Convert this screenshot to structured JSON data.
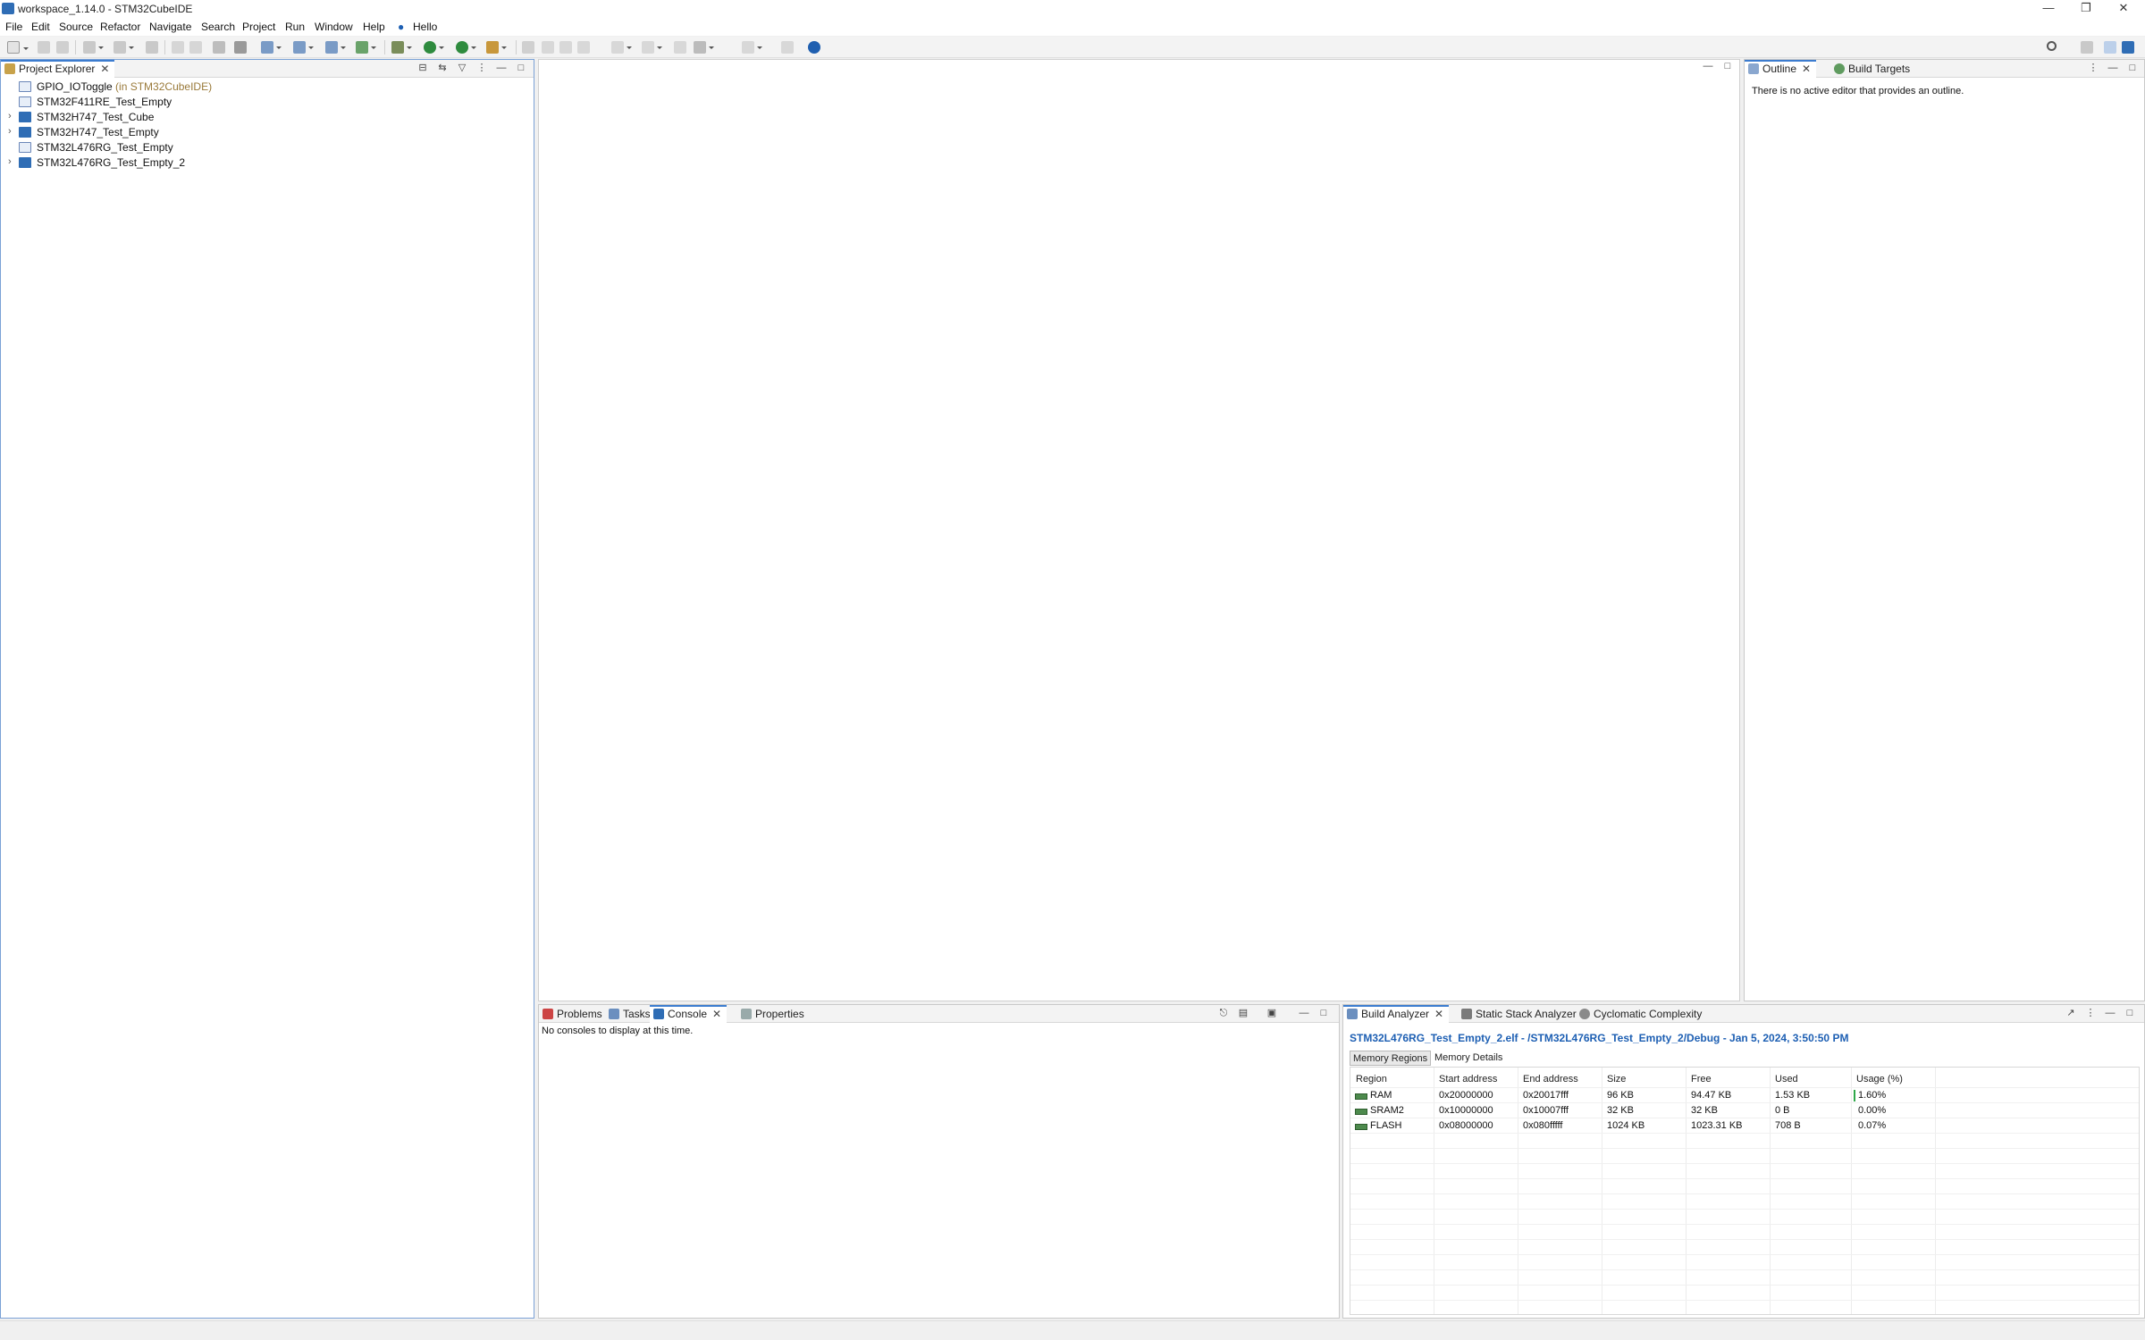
{
  "window": {
    "title": "workspace_1.14.0 - STM32CubeIDE"
  },
  "menu": [
    "File",
    "Edit",
    "Source",
    "Refactor",
    "Navigate",
    "Search",
    "Project",
    "Run",
    "Window",
    "Help",
    "Hello"
  ],
  "project_explorer": {
    "tab_label": "Project Explorer",
    "items": [
      {
        "label": "GPIO_IOToggle",
        "suffix": " (in STM32CubeIDE)",
        "expandable": false,
        "icon": "folder-icon"
      },
      {
        "label": "STM32F411RE_Test_Empty",
        "suffix": "",
        "expandable": false,
        "icon": "folder-icon"
      },
      {
        "label": "STM32H747_Test_Cube",
        "suffix": "",
        "expandable": true,
        "icon": "cube-project-icon"
      },
      {
        "label": "STM32H747_Test_Empty",
        "suffix": "",
        "expandable": true,
        "icon": "cube-project-icon"
      },
      {
        "label": "STM32L476RG_Test_Empty",
        "suffix": "",
        "expandable": false,
        "icon": "folder-icon"
      },
      {
        "label": "STM32L476RG_Test_Empty_2",
        "suffix": "",
        "expandable": true,
        "icon": "cube-project-icon"
      }
    ]
  },
  "outline": {
    "tab_outline": "Outline",
    "tab_build_targets": "Build Targets",
    "message": "There is no active editor that provides an outline."
  },
  "console": {
    "tabs": [
      "Problems",
      "Tasks",
      "Console",
      "Properties"
    ],
    "message": "No consoles to display at this time."
  },
  "build_analyzer": {
    "tabs": [
      "Build Analyzer",
      "Static Stack Analyzer",
      "Cyclomatic Complexity"
    ],
    "header": "STM32L476RG_Test_Empty_2.elf - /STM32L476RG_Test_Empty_2/Debug - Jan 5, 2024, 3:50:50 PM",
    "subtabs": [
      "Memory Regions",
      "Memory Details"
    ],
    "columns": [
      "Region",
      "Start address",
      "End address",
      "Size",
      "Free",
      "Used",
      "Usage (%)"
    ],
    "rows": [
      [
        "RAM",
        "0x20000000",
        "0x20017fff",
        "96 KB",
        "94.47 KB",
        "1.53 KB",
        "1.60%"
      ],
      [
        "SRAM2",
        "0x10000000",
        "0x10007fff",
        "32 KB",
        "32 KB",
        "0 B",
        "0.00%"
      ],
      [
        "FLASH",
        "0x08000000",
        "0x080fffff",
        "1024 KB",
        "1023.31 KB",
        "708 B",
        "0.07%"
      ]
    ],
    "usage_fraction": [
      0.016,
      0.0,
      0.0007
    ]
  },
  "colors": {
    "accent": "#3c7ccf",
    "link_blue": "#1d5fb3",
    "usage_green": "#2fa84a"
  }
}
